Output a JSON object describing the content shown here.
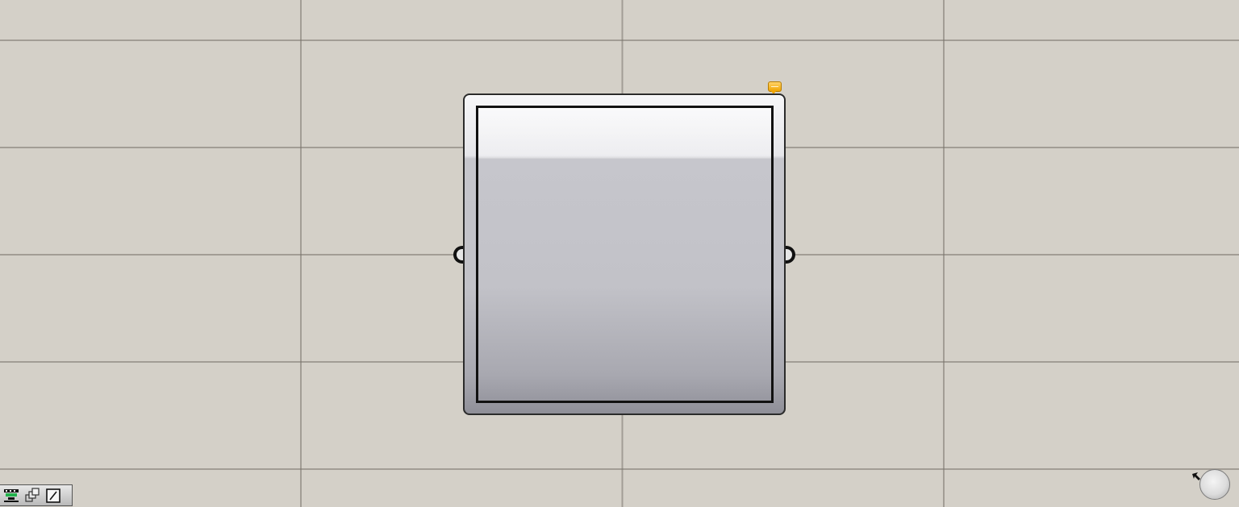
{
  "canvas": {
    "background": "#d4d0c8",
    "grid_color": "#8a857d"
  },
  "component": {
    "type": "panel",
    "fill_top": "#f6f6f8",
    "fill_bottom": "#8f8f98",
    "has_input_grip": true,
    "has_output_grip": true,
    "comment_marker": "comment-icon"
  },
  "toolbar": {
    "buttons": [
      {
        "name": "preview-mode-icon",
        "accent": "#22b14c"
      },
      {
        "name": "display-mode-icon"
      },
      {
        "name": "sketch-icon"
      }
    ]
  },
  "navigation": {
    "widget": "navigation-ball-icon"
  }
}
